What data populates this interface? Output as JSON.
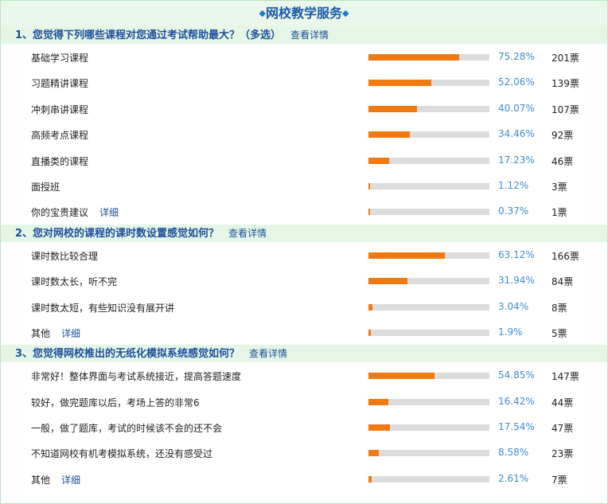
{
  "page_title": "网校教学服务",
  "title_star": "◆",
  "fill_color": "#f07a10",
  "questions": [
    {
      "title": "1、您觉得下列哪些课程对您通过考试帮助最大？（多选）",
      "detail_label": "查看详情",
      "options": [
        {
          "label": "基础学习课程",
          "percent": 75.28,
          "percent_text": "75.28%",
          "votes": "201票"
        },
        {
          "label": "习题精讲课程",
          "percent": 52.06,
          "percent_text": "52.06%",
          "votes": "139票"
        },
        {
          "label": "冲刺串讲课程",
          "percent": 40.07,
          "percent_text": "40.07%",
          "votes": "107票"
        },
        {
          "label": "高频考点课程",
          "percent": 34.46,
          "percent_text": "34.46%",
          "votes": "92票"
        },
        {
          "label": "直播类的课程",
          "percent": 17.23,
          "percent_text": "17.23%",
          "votes": "46票"
        },
        {
          "label": "面授班",
          "percent": 1.12,
          "percent_text": "1.12%",
          "votes": "3票"
        },
        {
          "label": "你的宝贵建议",
          "more": "详细",
          "percent": 0.37,
          "percent_text": "0.37%",
          "votes": "1票"
        }
      ]
    },
    {
      "title": "2、您对网校的课程的课时数设置感觉如何？",
      "detail_label": "查看详情",
      "options": [
        {
          "label": "课时数比较合理",
          "percent": 63.12,
          "percent_text": "63.12%",
          "votes": "166票"
        },
        {
          "label": "课时数太长，听不完",
          "percent": 31.94,
          "percent_text": "31.94%",
          "votes": "84票"
        },
        {
          "label": "课时数太短，有些知识没有展开讲",
          "percent": 3.04,
          "percent_text": "3.04%",
          "votes": "8票"
        },
        {
          "label": "其他",
          "more": "详细",
          "percent": 1.9,
          "percent_text": "1.9%",
          "votes": "5票"
        }
      ]
    },
    {
      "title": "3、您觉得网校推出的无纸化模拟系统感觉如何？",
      "detail_label": "查看详情",
      "options": [
        {
          "label": "非常好！整体界面与考试系统接近，提高答题速度",
          "percent": 54.85,
          "percent_text": "54.85%",
          "votes": "147票"
        },
        {
          "label": "较好，做完题库以后，考场上答的非常6",
          "percent": 16.42,
          "percent_text": "16.42%",
          "votes": "44票"
        },
        {
          "label": "一般，做了题库，考试的时候该不会的还不会",
          "percent": 17.54,
          "percent_text": "17.54%",
          "votes": "47票"
        },
        {
          "label": "不知道网校有机考模拟系统，还没有感受过",
          "percent": 8.58,
          "percent_text": "8.58%",
          "votes": "23票"
        },
        {
          "label": "其他",
          "more": "详细",
          "percent": 2.61,
          "percent_text": "2.61%",
          "votes": "7票"
        }
      ]
    }
  ]
}
